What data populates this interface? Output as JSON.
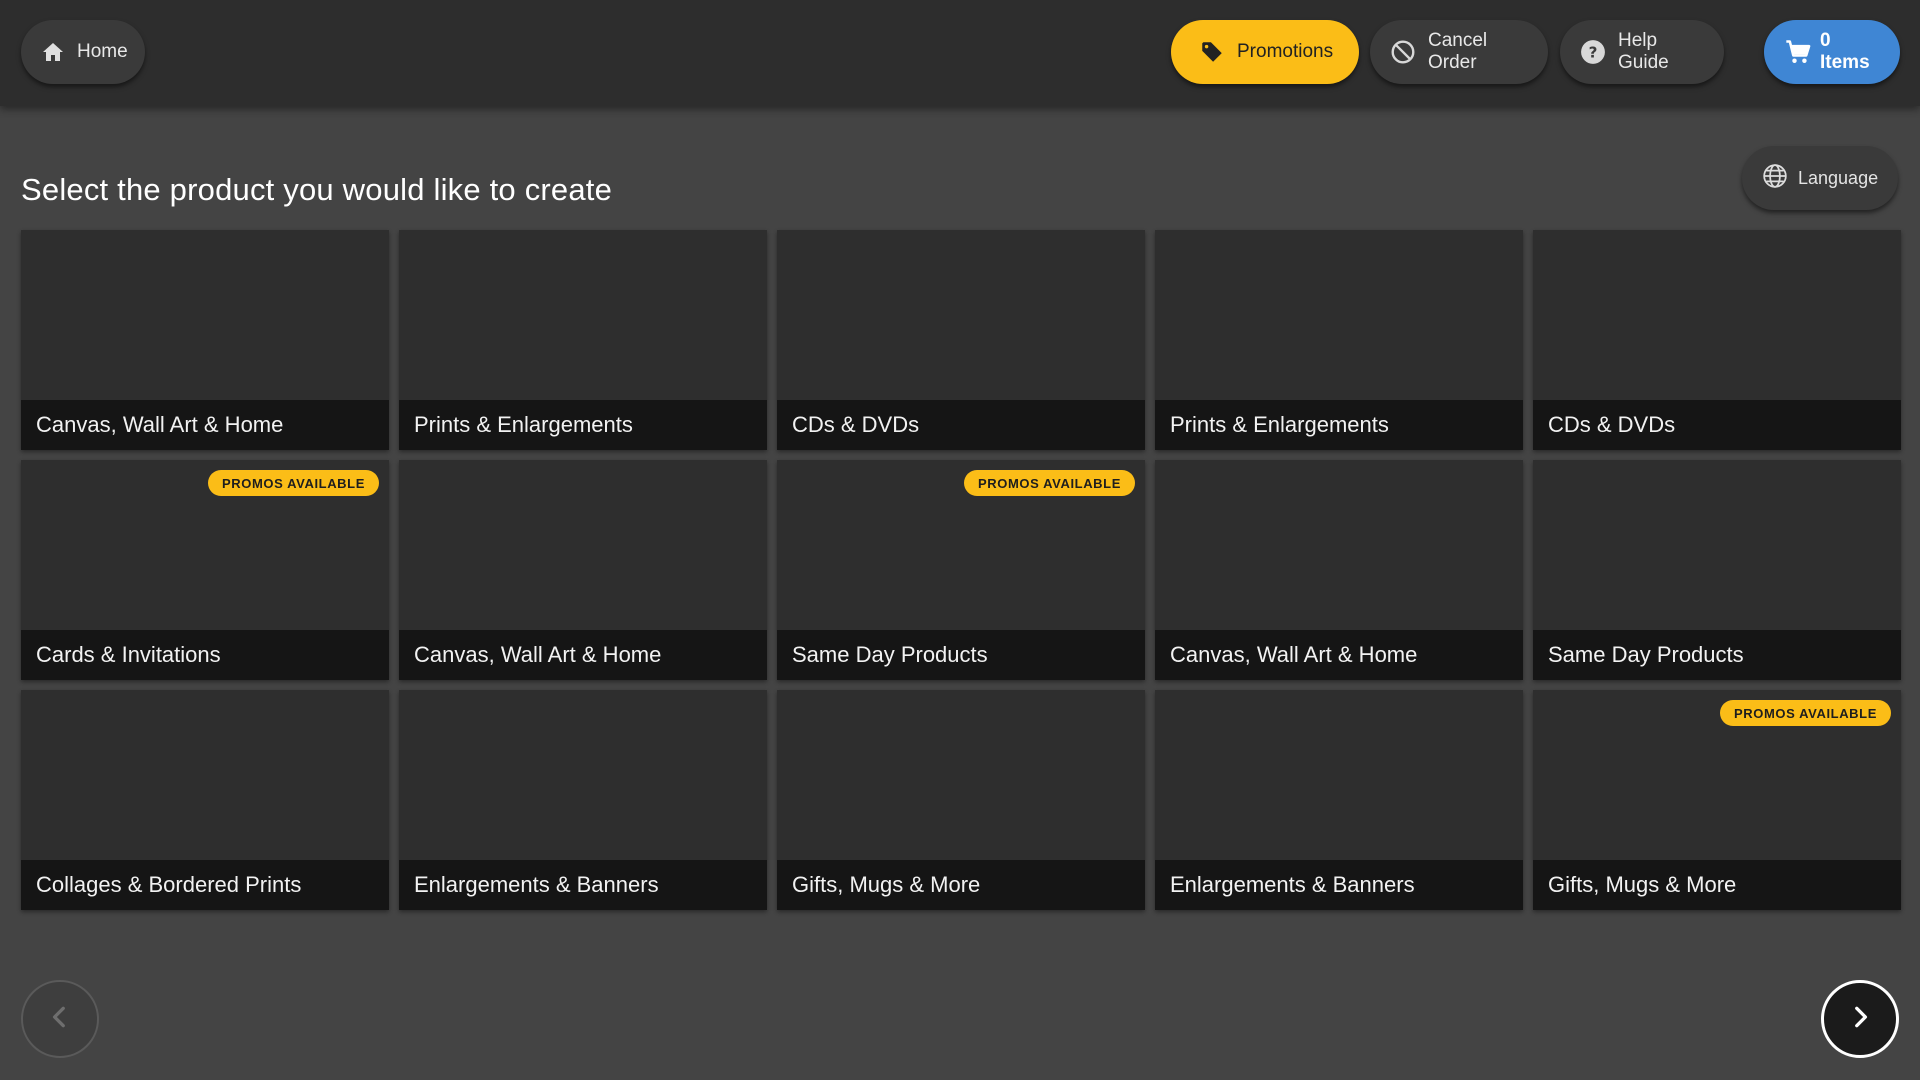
{
  "header": {
    "home_label": "Home",
    "promotions_label": "Promotions",
    "cancel_label": "Cancel Order",
    "help_label": "Help Guide",
    "cart_label": "0 Items"
  },
  "language_label": "Language",
  "title": "Select the product you would like to create",
  "promo_badge_text": "PROMOS AVAILABLE",
  "products": [
    {
      "label": "Canvas, Wall Art & Home",
      "promo": false
    },
    {
      "label": "Prints & Enlargements",
      "promo": false
    },
    {
      "label": "CDs & DVDs",
      "promo": false
    },
    {
      "label": "Prints & Enlargements",
      "promo": false
    },
    {
      "label": "CDs & DVDs",
      "promo": false
    },
    {
      "label": "Cards & Invitations",
      "promo": true
    },
    {
      "label": "Canvas, Wall Art & Home",
      "promo": false
    },
    {
      "label": "Same Day Products",
      "promo": true
    },
    {
      "label": "Canvas, Wall Art & Home",
      "promo": false
    },
    {
      "label": "Same Day Products",
      "promo": false
    },
    {
      "label": "Collages & Bordered Prints",
      "promo": false
    },
    {
      "label": "Enlargements & Banners",
      "promo": false
    },
    {
      "label": "Gifts, Mugs & More",
      "promo": false
    },
    {
      "label": "Enlargements & Banners",
      "promo": false
    },
    {
      "label": "Gifts, Mugs & More",
      "promo": true
    }
  ],
  "colors": {
    "accent_yellow": "#fbbd17",
    "cart_blue": "#3f86d4",
    "background": "#444444",
    "topbar": "#2d2d2d"
  },
  "icons": {
    "home": "home-icon",
    "promotions": "tag-icon",
    "cancel": "block-icon",
    "help": "help-icon",
    "cart": "cart-icon",
    "language": "globe-icon",
    "prev": "chevron-left-icon",
    "next": "chevron-right-icon"
  }
}
